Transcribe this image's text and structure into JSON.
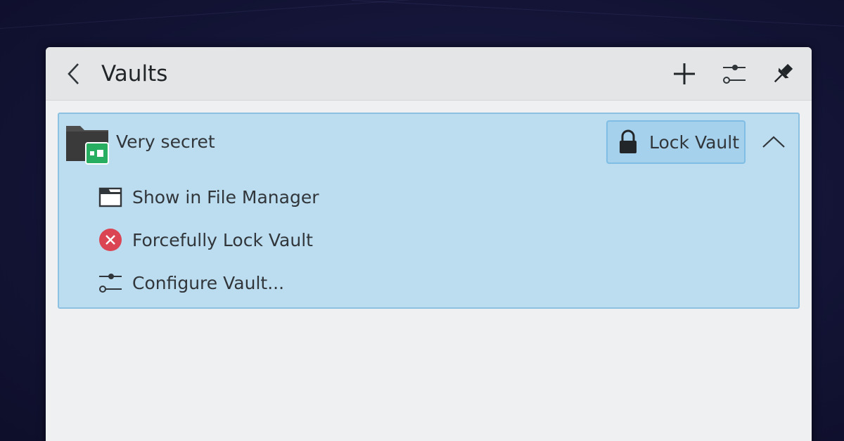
{
  "window": {
    "title": "Vaults"
  },
  "header": {
    "back_icon": "chevron-left-icon",
    "add_icon": "plus-icon",
    "configure_icon": "sliders-icon",
    "pin_icon": "pin-icon"
  },
  "vault": {
    "name": "Very secret",
    "icon": "encrypted-folder-icon",
    "lock_button_label": "Lock Vault",
    "lock_icon": "padlock-icon",
    "collapse_icon": "chevron-up-icon",
    "actions": [
      {
        "label": "Show in File Manager",
        "icon": "folder-window-icon"
      },
      {
        "label": "Forcefully Lock Vault",
        "icon": "error-x-icon"
      },
      {
        "label": "Configure Vault...",
        "icon": "sliders-icon"
      }
    ]
  },
  "colors": {
    "highlight_bg": "#bcdcef",
    "highlight_border": "#8cc1e2",
    "error_red": "#da4453",
    "vault_green": "#27ae60"
  }
}
